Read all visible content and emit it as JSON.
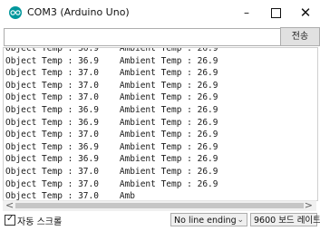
{
  "window": {
    "title": "COM3 (Arduino Uno)",
    "controls": {
      "minimize": "–",
      "close": "✕"
    }
  },
  "send": {
    "input_value": "",
    "button_label": "전송"
  },
  "monitor": {
    "lines": [
      "Object Temp : 36.9    Ambient Temp : 26.9",
      "Object Temp : 36.9    Ambient Temp : 26.9",
      "Object Temp : 37.0    Ambient Temp : 26.9",
      "Object Temp : 37.0    Ambient Temp : 26.9",
      "Object Temp : 37.0    Ambient Temp : 26.9",
      "Object Temp : 36.9    Ambient Temp : 26.9",
      "Object Temp : 36.9    Ambient Temp : 26.9",
      "Object Temp : 37.0    Ambient Temp : 26.9",
      "Object Temp : 36.9    Ambient Temp : 26.9",
      "Object Temp : 36.9    Ambient Temp : 26.9",
      "Object Temp : 37.0    Ambient Temp : 26.9",
      "Object Temp : 37.0    Ambient Temp : 26.9",
      "Object Temp : 37.0    Amb"
    ]
  },
  "scrollbar": {
    "left_arrow": "<",
    "right_arrow": ">"
  },
  "status": {
    "autoscroll_label": "자동 스크롤",
    "autoscroll_checked": true,
    "line_ending": "No line ending",
    "baud_rate": "9600 보드 레이트"
  },
  "colors": {
    "accent": "#00979c"
  }
}
